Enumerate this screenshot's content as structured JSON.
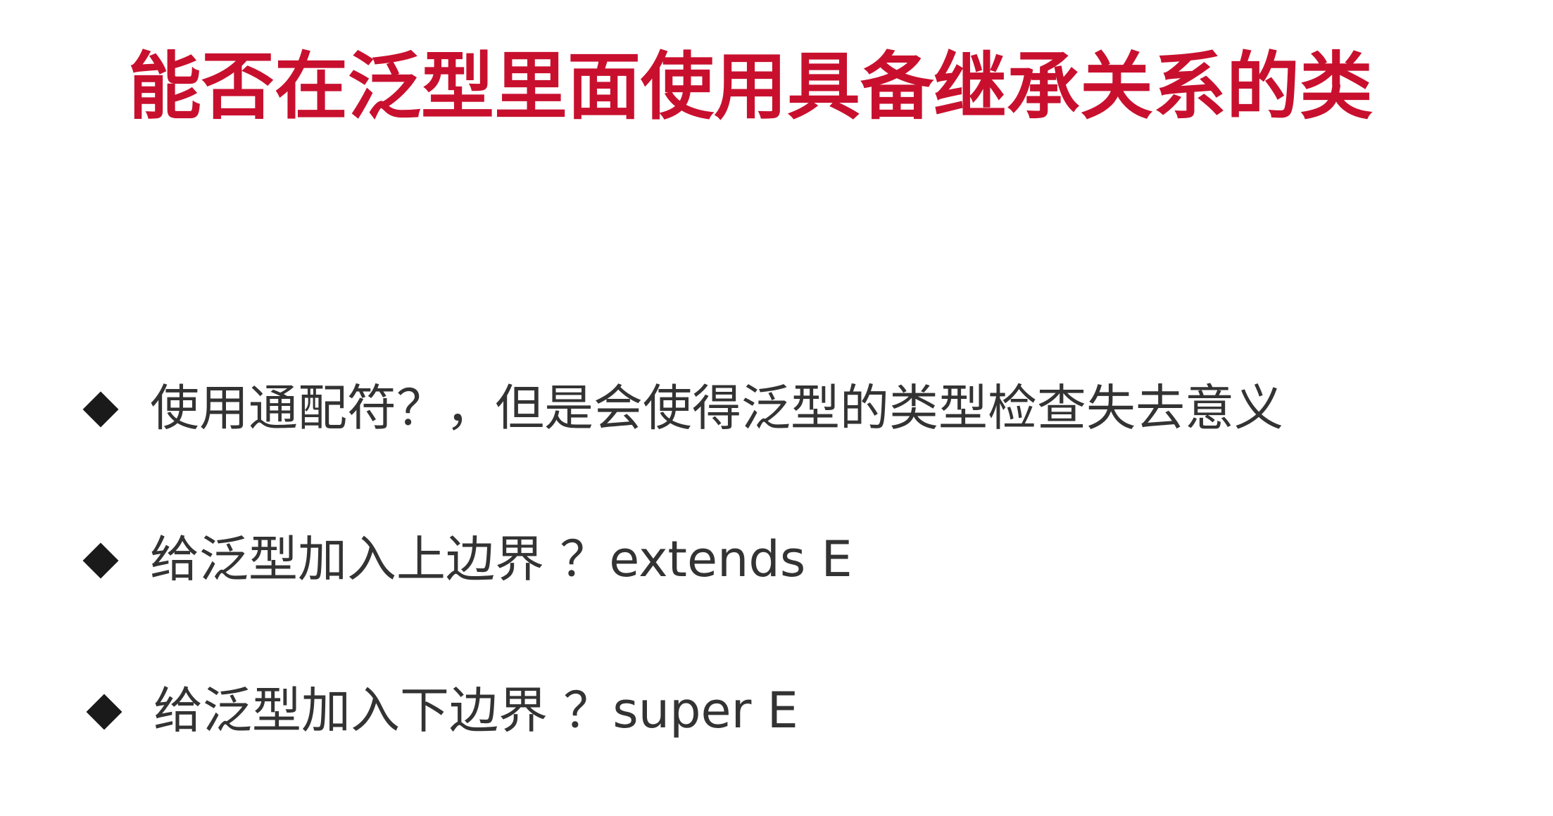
{
  "slide": {
    "title": "能否在泛型里面使用具备继承关系的类",
    "bullets": [
      {
        "marker_icon": "diamond-bullet-icon",
        "text": "使用通配符？，但是会使得泛型的类型检查失去意义"
      },
      {
        "marker_icon": "diamond-bullet-icon",
        "text": "给泛型加入上边界 ？extends E"
      },
      {
        "marker_icon": "diamond-bullet-icon",
        "text": "给泛型加入下边界 ？super E"
      }
    ],
    "colors": {
      "title": "#c8102e",
      "text": "#333333",
      "marker": "#1a1a1a",
      "background": "#ffffff"
    }
  }
}
